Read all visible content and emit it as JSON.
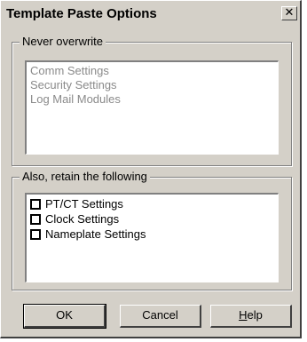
{
  "window": {
    "title": "Template Paste Options",
    "close_glyph": "✕"
  },
  "never_overwrite": {
    "label": "Never overwrite",
    "items": [
      "Comm Settings",
      "Security Settings",
      "Log Mail Modules"
    ]
  },
  "retain": {
    "label": "Also, retain the following",
    "items": [
      {
        "label": "PT/CT Settings",
        "checked": false
      },
      {
        "label": "Clock Settings",
        "checked": false
      },
      {
        "label": "Nameplate Settings",
        "checked": false
      }
    ]
  },
  "buttons": {
    "ok": "OK",
    "cancel": "Cancel",
    "help_mnemonic": "H",
    "help_rest": "elp"
  }
}
